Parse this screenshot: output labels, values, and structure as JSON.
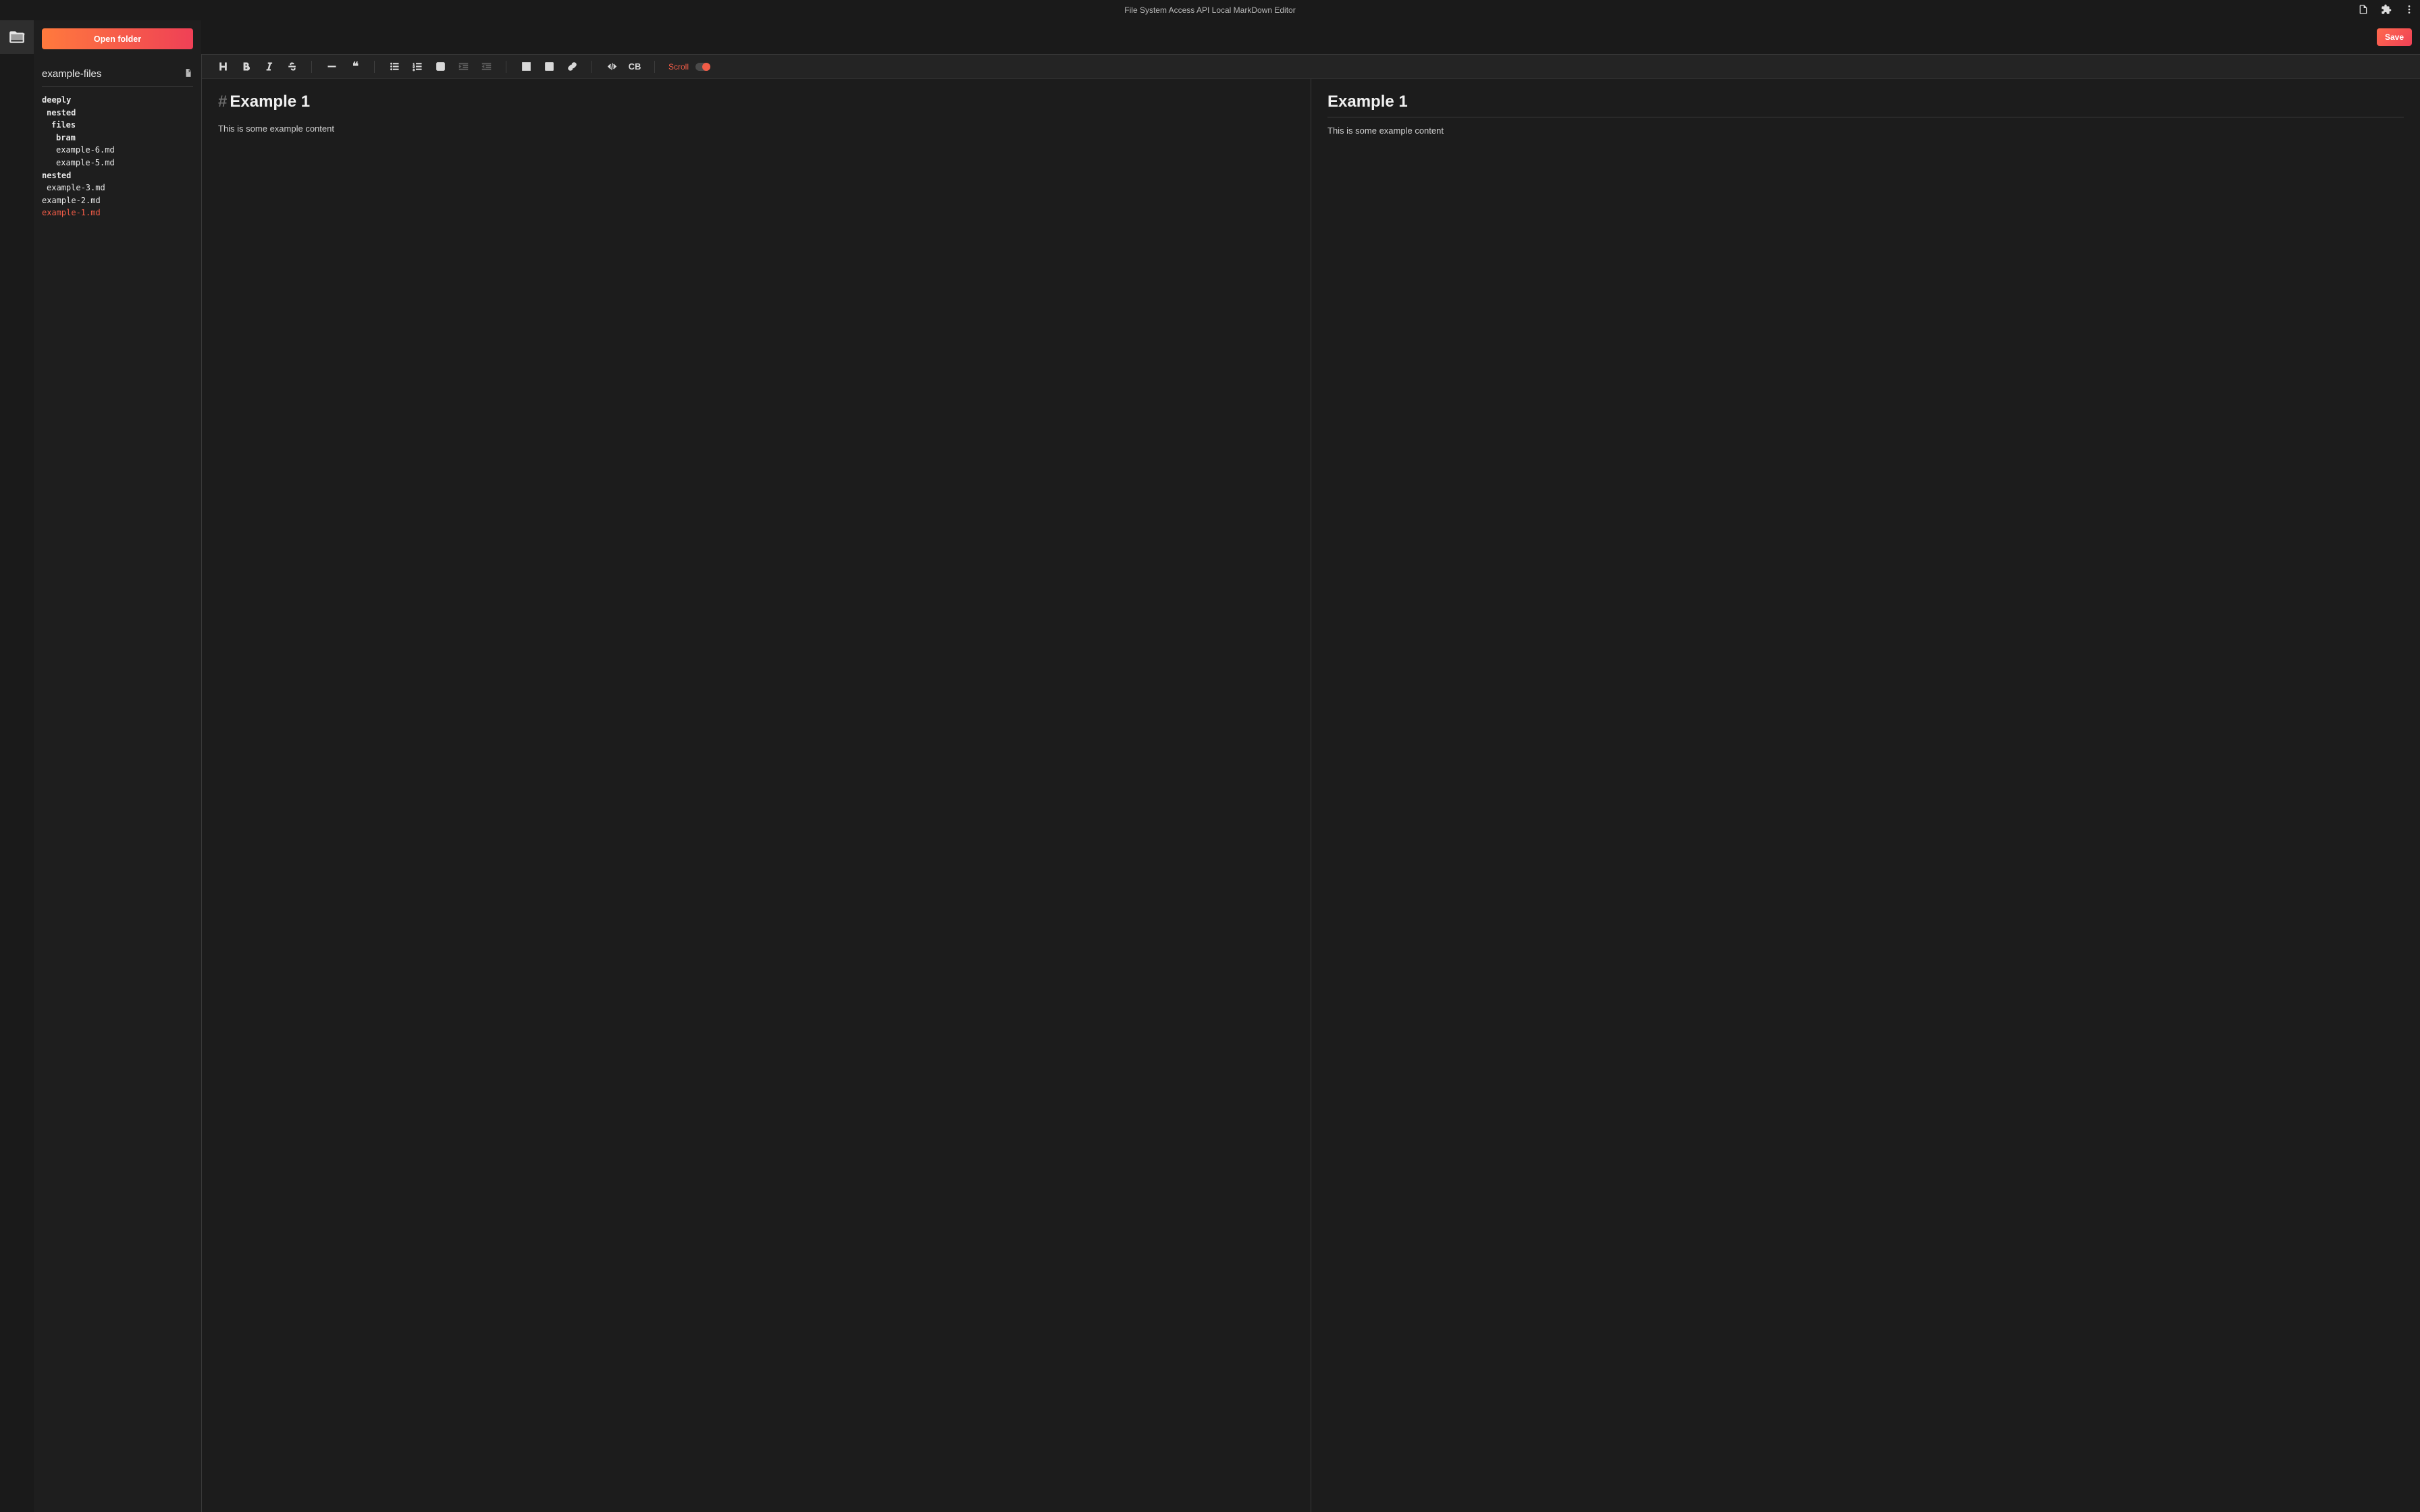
{
  "chrome": {
    "title": "File System Access API Local MarkDown Editor"
  },
  "sidebar": {
    "open_folder_label": "Open folder",
    "folder_name": "example-files",
    "tree": [
      {
        "label": "deeply",
        "type": "dir",
        "indent": 0
      },
      {
        "label": "nested",
        "type": "dir",
        "indent": 1
      },
      {
        "label": "files",
        "type": "dir",
        "indent": 2
      },
      {
        "label": "bram",
        "type": "dir",
        "indent": 3
      },
      {
        "label": "example-6.md",
        "type": "file",
        "indent": 3
      },
      {
        "label": "example-5.md",
        "type": "file",
        "indent": 3
      },
      {
        "label": "nested",
        "type": "dir",
        "indent": 0
      },
      {
        "label": "example-3.md",
        "type": "file",
        "indent": 1
      },
      {
        "label": "example-2.md",
        "type": "file",
        "indent": 0
      },
      {
        "label": "example-1.md",
        "type": "file",
        "indent": 0,
        "active": true
      }
    ]
  },
  "actions": {
    "save_label": "Save"
  },
  "toolbar": {
    "scroll_label": "Scroll",
    "scroll_on": true,
    "tools": {
      "heading": "H",
      "bold": "B",
      "italic": "I",
      "strike": "S",
      "hr": "—",
      "quote": "❝",
      "ul": "•",
      "ol": "1.",
      "task": "☑",
      "indent": "→",
      "outdent": "←",
      "table": "▦",
      "image": "🖼",
      "link": "🔗",
      "code": "</>",
      "codeblock": "CB"
    }
  },
  "editor": {
    "hash": "#",
    "title": "Example 1",
    "body": "This is some example content"
  },
  "preview": {
    "title": "Example 1",
    "body": "This is some example content"
  }
}
